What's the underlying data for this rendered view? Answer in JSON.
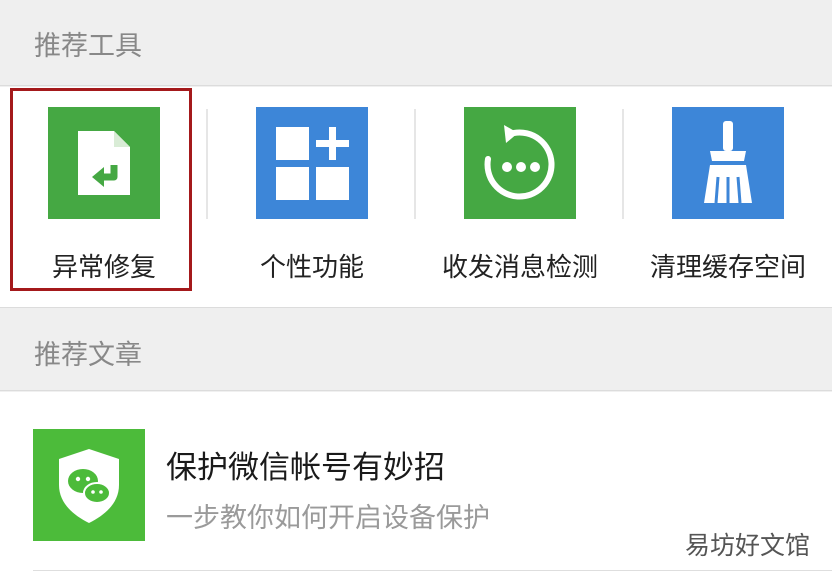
{
  "sections": {
    "tools_title": "推荐工具",
    "articles_title": "推荐文章"
  },
  "tools": [
    {
      "label": "异常修复",
      "icon": "file-repair-icon",
      "color": "#45a843",
      "highlighted": true
    },
    {
      "label": "个性功能",
      "icon": "grid-plus-icon",
      "color": "#3d86d8"
    },
    {
      "label": "收发消息检测",
      "icon": "refresh-dots-icon",
      "color": "#45a843"
    },
    {
      "label": "清理缓存空间",
      "icon": "broom-icon",
      "color": "#3d86d8"
    }
  ],
  "article": {
    "title": "保护微信帐号有妙招",
    "description": "一步教你如何开启设备保护",
    "icon": "wechat-shield-icon",
    "color": "#4cbb3a"
  },
  "highlight_color": "#a4191b",
  "watermark": "易坊好文馆"
}
